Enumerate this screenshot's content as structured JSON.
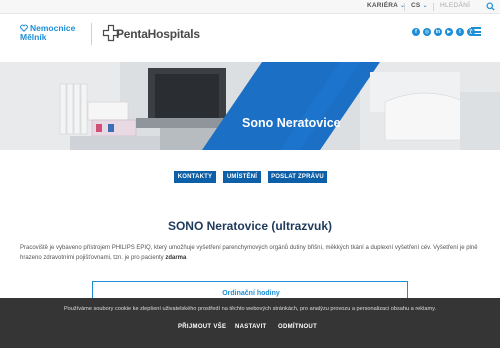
{
  "topbar": {
    "career_label": "KARIÉRA",
    "language_label": "CS",
    "search_placeholder": "HLEDÁNÍ"
  },
  "header": {
    "hospital_name_line1": "Nemocnice",
    "hospital_name_line2": "Mělník",
    "group_logo_text": "PentaHospitals",
    "social_icons": [
      "facebook-icon",
      "instagram-icon",
      "linkedin-icon",
      "youtube-icon",
      "twitter-icon",
      "rss-icon"
    ]
  },
  "hero": {
    "title": "Sono Neratovice"
  },
  "actions": {
    "contacts_label": "KONTAKTY",
    "location_label": "UMÍSTĚNÍ",
    "send_message_label": "POSLAT ZPRÁVU"
  },
  "main": {
    "page_title": "SONO Neratovice (ultrazvuk)",
    "description": "Pracoviště je vybaveno přístrojem PHILIPS EPIQ, který umožňuje vyšetření parenchymových orgánů dutiny břišní, měkkých tkání a duplexní vyšetření cév. Vyšetření je plně hrazeno zdravotními pojišťovnami, tzn. je pro pacienty",
    "description_bold": "zdarma",
    "card_link": "Ordinační hodiny"
  },
  "cookie": {
    "text": "Používáme soubory cookie ke zlepšení uživatelského prostředí na těchto webových stránkách, pro analýzu provozu a personalizaci obsahu a reklamy.",
    "accept_all_label": "PŘIJMOUT VŠE",
    "settings_label": "NASTAVIT",
    "reject_label": "ODMÍTNOUT"
  },
  "colors": {
    "accent": "#1d8fd6",
    "button": "#0d5fa8",
    "hero_band": "#1b6fc4",
    "cookie_bg": "#353535"
  }
}
